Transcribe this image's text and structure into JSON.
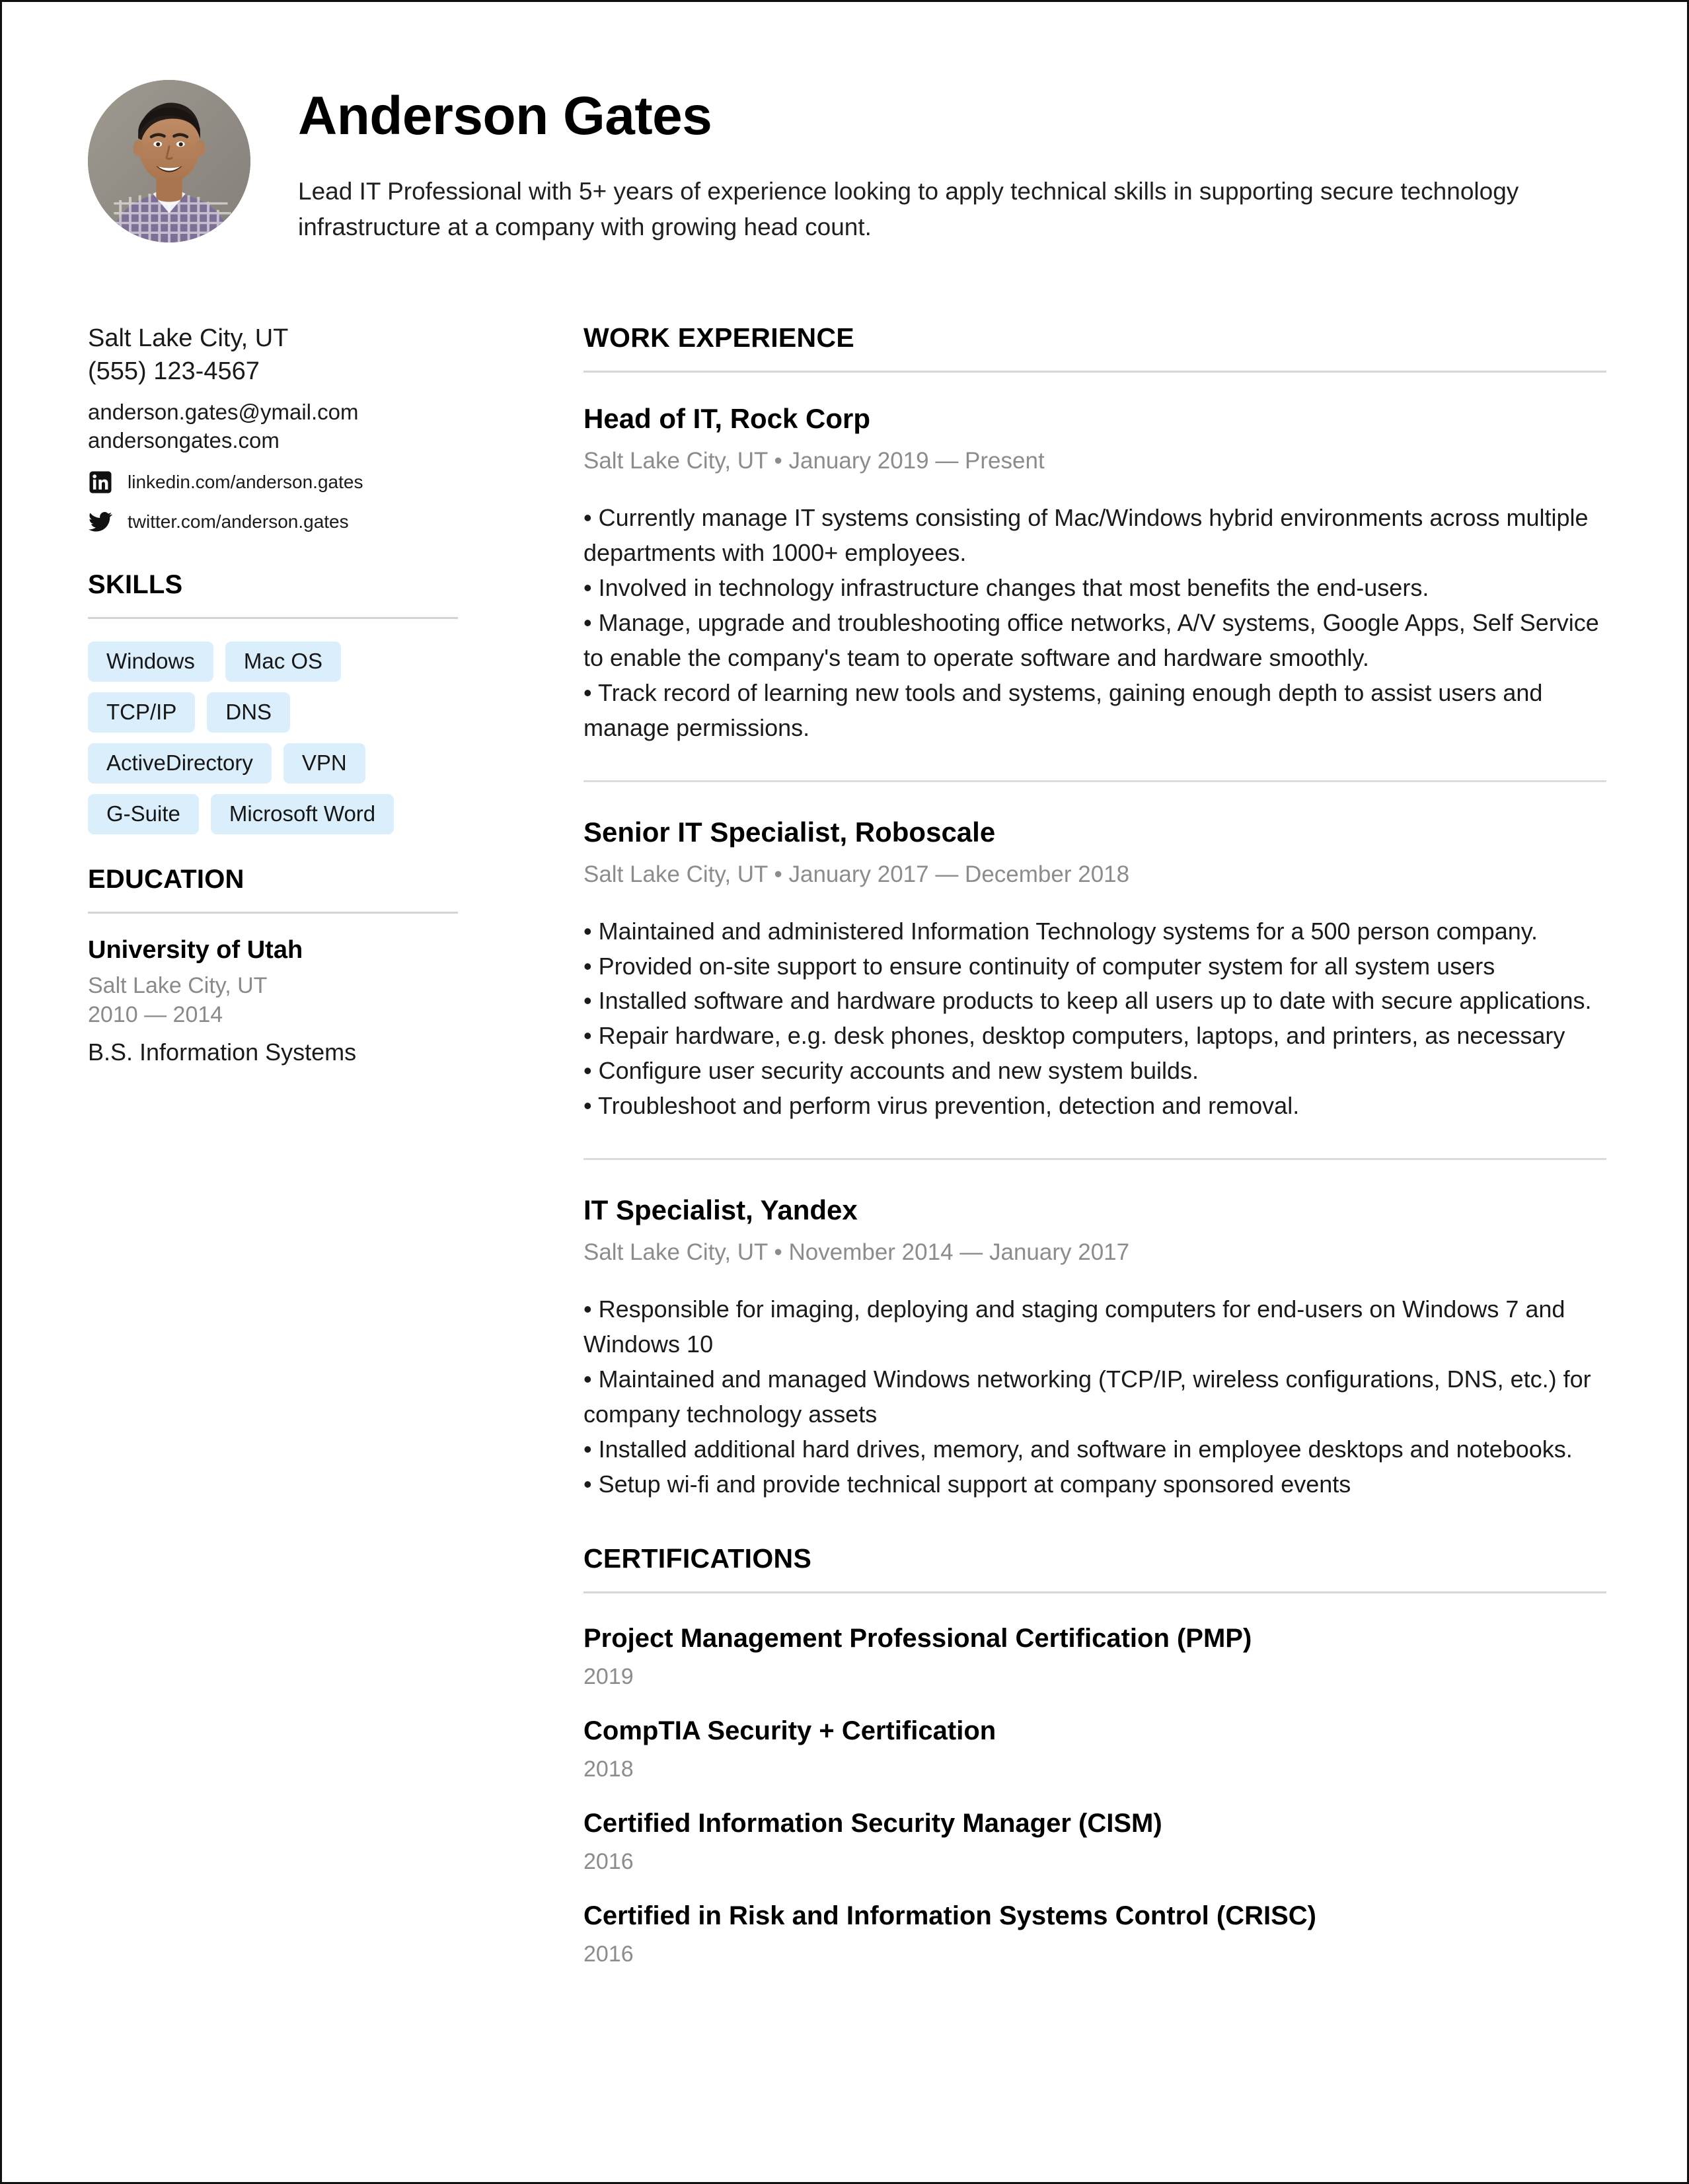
{
  "header": {
    "name": "Anderson Gates",
    "summary": "Lead IT Professional with 5+ years of experience looking to apply technical skills in supporting secure technology infrastructure at a company with growing head count.",
    "avatar_alt": "profile-photo"
  },
  "contact": {
    "location": "Salt Lake City, UT",
    "phone": "(555) 123-4567",
    "email": "anderson.gates@ymail.com",
    "website": "andersongates.com",
    "linkedin": "linkedin.com/anderson.gates",
    "twitter": "twitter.com/anderson.gates",
    "linkedin_icon": "linkedin-icon",
    "twitter_icon": "twitter-icon"
  },
  "skills": {
    "heading": "SKILLS",
    "rows": [
      [
        "Windows",
        "Mac OS"
      ],
      [
        "TCP/IP",
        "DNS"
      ],
      [
        "ActiveDirectory",
        "VPN"
      ],
      [
        "G-Suite",
        "Microsoft Word"
      ]
    ],
    "tag_color": "#daeefb"
  },
  "education": {
    "heading": "EDUCATION",
    "school": "University of Utah",
    "location": "Salt Lake City, UT",
    "years": "2010 — 2014",
    "degree": "B.S. Information Systems"
  },
  "work": {
    "heading": "WORK EXPERIENCE",
    "jobs": [
      {
        "title": "Head of IT, Rock Corp",
        "meta": "Salt Lake City, UT • January 2019 — Present",
        "bullets": [
          "• Currently manage IT systems consisting of Mac/Windows hybrid environments across multiple departments with 1000+ employees.",
          "• Involved in technology infrastructure changes that most benefits the end-users.",
          "• Manage, upgrade and troubleshooting office networks, A/V systems, Google Apps, Self Service to enable the company's team to operate software and hardware smoothly.",
          "• Track record of learning new tools and systems, gaining enough depth to assist users and manage permissions."
        ]
      },
      {
        "title": "Senior IT Specialist, Roboscale",
        "meta": "Salt Lake City, UT • January 2017 — December 2018",
        "bullets": [
          "• Maintained and administered Information Technology systems for a 500 person company.",
          "• Provided on-site support to ensure continuity of computer system for all system users",
          "• Installed software and hardware products to keep all users up to date with secure applications.",
          "• Repair hardware, e.g. desk phones, desktop computers, laptops, and printers, as necessary",
          "• Configure user security accounts and new system builds.",
          "• Troubleshoot and perform virus prevention, detection and removal."
        ]
      },
      {
        "title": "IT Specialist, Yandex",
        "meta": "Salt Lake City, UT • November 2014 — January 2017",
        "bullets": [
          "• Responsible for imaging, deploying and staging computers for end-users on Windows 7 and Windows 10",
          "• Maintained and managed Windows networking (TCP/IP, wireless configurations, DNS, etc.) for company technology assets",
          "• Installed additional hard drives, memory, and software in employee desktops and notebooks.",
          "• Setup wi-fi and provide technical support at company sponsored events"
        ]
      }
    ]
  },
  "certifications": {
    "heading": "CERTIFICATIONS",
    "items": [
      {
        "name": "Project Management Professional Certification (PMP)",
        "year": "2019"
      },
      {
        "name": "CompTIA Security + Certification",
        "year": "2018"
      },
      {
        "name": "Certified Information Security Manager (CISM)",
        "year": "2016"
      },
      {
        "name": "Certified in Risk and Information Systems Control (CRISC)",
        "year": "2016"
      }
    ]
  }
}
